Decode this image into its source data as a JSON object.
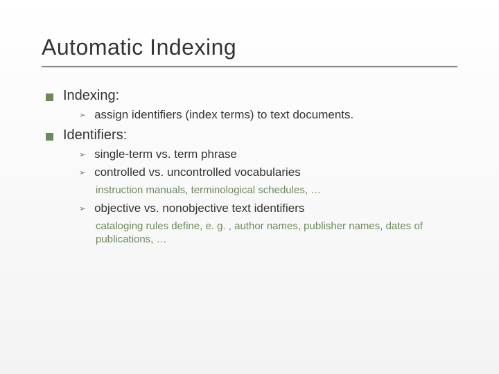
{
  "title": "Automatic Indexing",
  "sections": [
    {
      "heading": "Indexing:",
      "items": [
        {
          "text": "assign identifiers (index terms) to text documents."
        }
      ]
    },
    {
      "heading": "Identifiers:",
      "items": [
        {
          "text": "single-term vs. term phrase"
        },
        {
          "text": "controlled vs. uncontrolled vocabularies",
          "desc": "instruction manuals, terminological schedules, …"
        },
        {
          "text": "objective vs. nonobjective text identifiers",
          "desc": "cataloging rules define, e. g. , author names, publisher names, dates of publications, …"
        }
      ]
    }
  ]
}
